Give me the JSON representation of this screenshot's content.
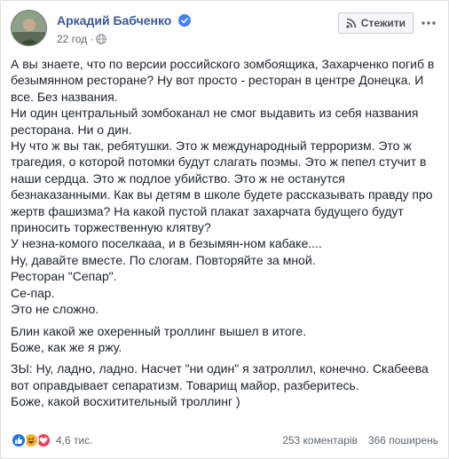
{
  "post": {
    "author": "Аркадий Бабченко",
    "time": "22 год",
    "follow_label": "Стежити",
    "paragraphs": [
      [
        "А вы знаете, что по версии российского зомбоящика, Захарченко погиб в безымянном ресторане? Ну вот просто - ресторан в центре Донецка. И все. Без названия.",
        "Ни один центральный зомбоканал не смог выдавить из себя названия ресторана. Ни о дин.",
        "Ну что ж вы так, ребятушки. Это ж международный терроризм. Это ж трагедия, о которой потомки будут слагать поэмы. Это ж пепел стучит в наши сердца. Это ж подлое убийство. Это ж не останутся безнаказанными. Как вы детям в школе будете рассказывать правду про жертв фашизма? На какой пустой плакат захарчата будущего будут приносить торжественную клятву?",
        "У незна-комого поселкааа, и в безымян-ном кабаке....",
        "Ну, давайте вместе. По слогам. Повторяйте за мной.",
        "Ресторан \"Сепар\".",
        "Се-пар.",
        "Это не сложно."
      ],
      [
        "Блин какой же охеренный троллинг вышел в итоге.",
        "Боже, как же я ржу."
      ],
      [
        "ЗЫ: Ну, ладно, ладно. Насчет \"ни один\" я затроллил, конечно. Скабеева вот оправдывает сепаратизм. Товарищ майор, разберитесь.",
        "Боже, какой восхитительный троллинг )"
      ]
    ]
  },
  "footer": {
    "reaction_count": "4,6 тис.",
    "comments": "253 коментарів",
    "shares": "366 поширень"
  },
  "colors": {
    "link": "#385898",
    "like": "#1877f2",
    "haha": "#f7b125",
    "love": "#f33e58"
  },
  "icons": [
    "verified-badge-icon",
    "globe-icon",
    "rss-icon",
    "more-icon",
    "like-reaction-icon",
    "haha-reaction-icon",
    "love-reaction-icon"
  ]
}
